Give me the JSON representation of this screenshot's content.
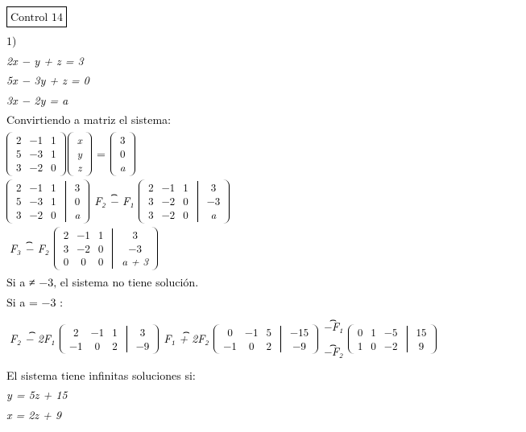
{
  "title": "Control 14",
  "item_number": "1)",
  "equations": {
    "eq1": "2x − y + z = 3",
    "eq2": "5x − 3y + z = 0",
    "eq3": "3x − 2y = a"
  },
  "convert_text": "Convirtiendo a matriz el sistema:",
  "matrix_form": {
    "A": [
      [
        "2",
        "−1",
        "1"
      ],
      [
        "5",
        "−3",
        "1"
      ],
      [
        "3",
        "−2",
        "0"
      ]
    ],
    "x": [
      "x",
      "y",
      "z"
    ],
    "equals": "=",
    "b": [
      "3",
      "0",
      "a"
    ]
  },
  "step1": {
    "aug1": {
      "A": [
        [
          "2",
          "−1",
          "1"
        ],
        [
          "5",
          "−3",
          "1"
        ],
        [
          "3",
          "−2",
          "0"
        ]
      ],
      "b": [
        "3",
        "0",
        "a"
      ]
    },
    "op1": "F₂ − F₁",
    "aug2": {
      "A": [
        [
          "2",
          "−1",
          "1"
        ],
        [
          "3",
          "−2",
          "0"
        ],
        [
          "3",
          "−2",
          "0"
        ]
      ],
      "b": [
        "3",
        "−3",
        "a"
      ]
    }
  },
  "step2": {
    "op2": "F₃ − F₂",
    "aug3": {
      "A": [
        [
          "2",
          "−1",
          "1"
        ],
        [
          "3",
          "−2",
          "0"
        ],
        [
          "0",
          "0",
          "0"
        ]
      ],
      "b": [
        "3",
        "−3",
        "a + 3"
      ]
    }
  },
  "case1": "Si a ≠ −3, el sistema no tiene solución.",
  "case2": "Si a = −3 :",
  "step3": {
    "op3": "F₂ − 2F₁",
    "aug4": {
      "A": [
        [
          "2",
          "−1",
          "1"
        ],
        [
          "−1",
          "0",
          "2"
        ]
      ],
      "b": [
        "3",
        "−9"
      ]
    },
    "op4": "F₁ + 2F₂",
    "aug5": {
      "A": [
        [
          "0",
          "−1",
          "5"
        ],
        [
          "−1",
          "0",
          "2"
        ]
      ],
      "b": [
        "−15",
        "−9"
      ]
    },
    "op5a": "−F₁",
    "op5b": "−F₂",
    "aug6": {
      "A": [
        [
          "0",
          "1",
          "−5"
        ],
        [
          "1",
          "0",
          "−2"
        ]
      ],
      "b": [
        "15",
        "9"
      ]
    }
  },
  "infinite_text": "El sistema tiene infinitas soluciones si:",
  "sol_y": "y = 5z + 15",
  "sol_x": "x = 2z + 9"
}
